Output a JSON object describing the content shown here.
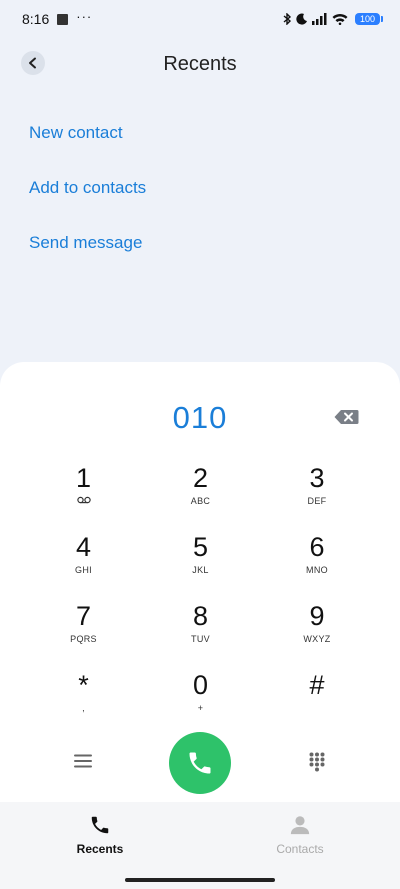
{
  "status_bar": {
    "time": "8:16",
    "dots": "···",
    "battery": "100"
  },
  "header": {
    "title": "Recents"
  },
  "actions": [
    {
      "label": "New contact"
    },
    {
      "label": "Add to contacts"
    },
    {
      "label": "Send message"
    }
  ],
  "dialer": {
    "number": "010",
    "keys": [
      {
        "digit": "1",
        "letters": ""
      },
      {
        "digit": "2",
        "letters": "ABC"
      },
      {
        "digit": "3",
        "letters": "DEF"
      },
      {
        "digit": "4",
        "letters": "GHI"
      },
      {
        "digit": "5",
        "letters": "JKL"
      },
      {
        "digit": "6",
        "letters": "MNO"
      },
      {
        "digit": "7",
        "letters": "PQRS"
      },
      {
        "digit": "8",
        "letters": "TUV"
      },
      {
        "digit": "9",
        "letters": "WXYZ"
      },
      {
        "digit": "*",
        "letters": ","
      },
      {
        "digit": "0",
        "letters": "+"
      },
      {
        "digit": "#",
        "letters": ""
      }
    ]
  },
  "nav": {
    "recents_label": "Recents",
    "contacts_label": "Contacts"
  },
  "colors": {
    "accent": "#1a7ed8",
    "call": "#2ec26a",
    "background": "#eef2f9"
  }
}
